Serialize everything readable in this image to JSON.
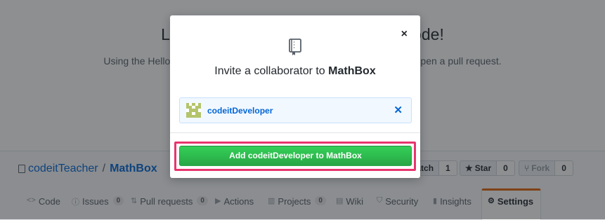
{
  "background": {
    "hero_title": "Learn Git and GitHub without any code!",
    "hero_subtitle": "Using the Hello World guide, you’ll start a branch, write comments, and open a pull request."
  },
  "repo": {
    "owner": "codeitTeacher",
    "separator": "/",
    "name": "MathBox",
    "watch_label": "Watch",
    "watch_count": "1",
    "star_label": "Star",
    "star_count": "0",
    "fork_label": "Fork",
    "fork_count": "0"
  },
  "tabs": [
    {
      "label": "Code",
      "icon": "code-icon",
      "count": ""
    },
    {
      "label": "Issues",
      "icon": "issue-icon",
      "count": "0"
    },
    {
      "label": "Pull requests",
      "icon": "pull-request-icon",
      "count": "0"
    },
    {
      "label": "Actions",
      "icon": "play-icon",
      "count": ""
    },
    {
      "label": "Projects",
      "icon": "project-icon",
      "count": "0"
    },
    {
      "label": "Wiki",
      "icon": "book-icon",
      "count": ""
    },
    {
      "label": "Security",
      "icon": "shield-icon",
      "count": ""
    },
    {
      "label": "Insights",
      "icon": "graph-icon",
      "count": ""
    },
    {
      "label": "Settings",
      "icon": "gear-icon",
      "count": "",
      "selected": true
    }
  ],
  "modal": {
    "title_prefix": "Invite a collaborator to ",
    "title_repo": "MathBox",
    "close_label": "×",
    "user": {
      "username": "codeitDeveloper",
      "remove_label": "✕"
    },
    "add_button_label": "Add codeitDeveloper to MathBox"
  },
  "colors": {
    "accent_link": "#0366d6",
    "primary_button": "#2ea44f",
    "highlight_border": "#e8356e",
    "selected_tab_border": "#e36209"
  }
}
